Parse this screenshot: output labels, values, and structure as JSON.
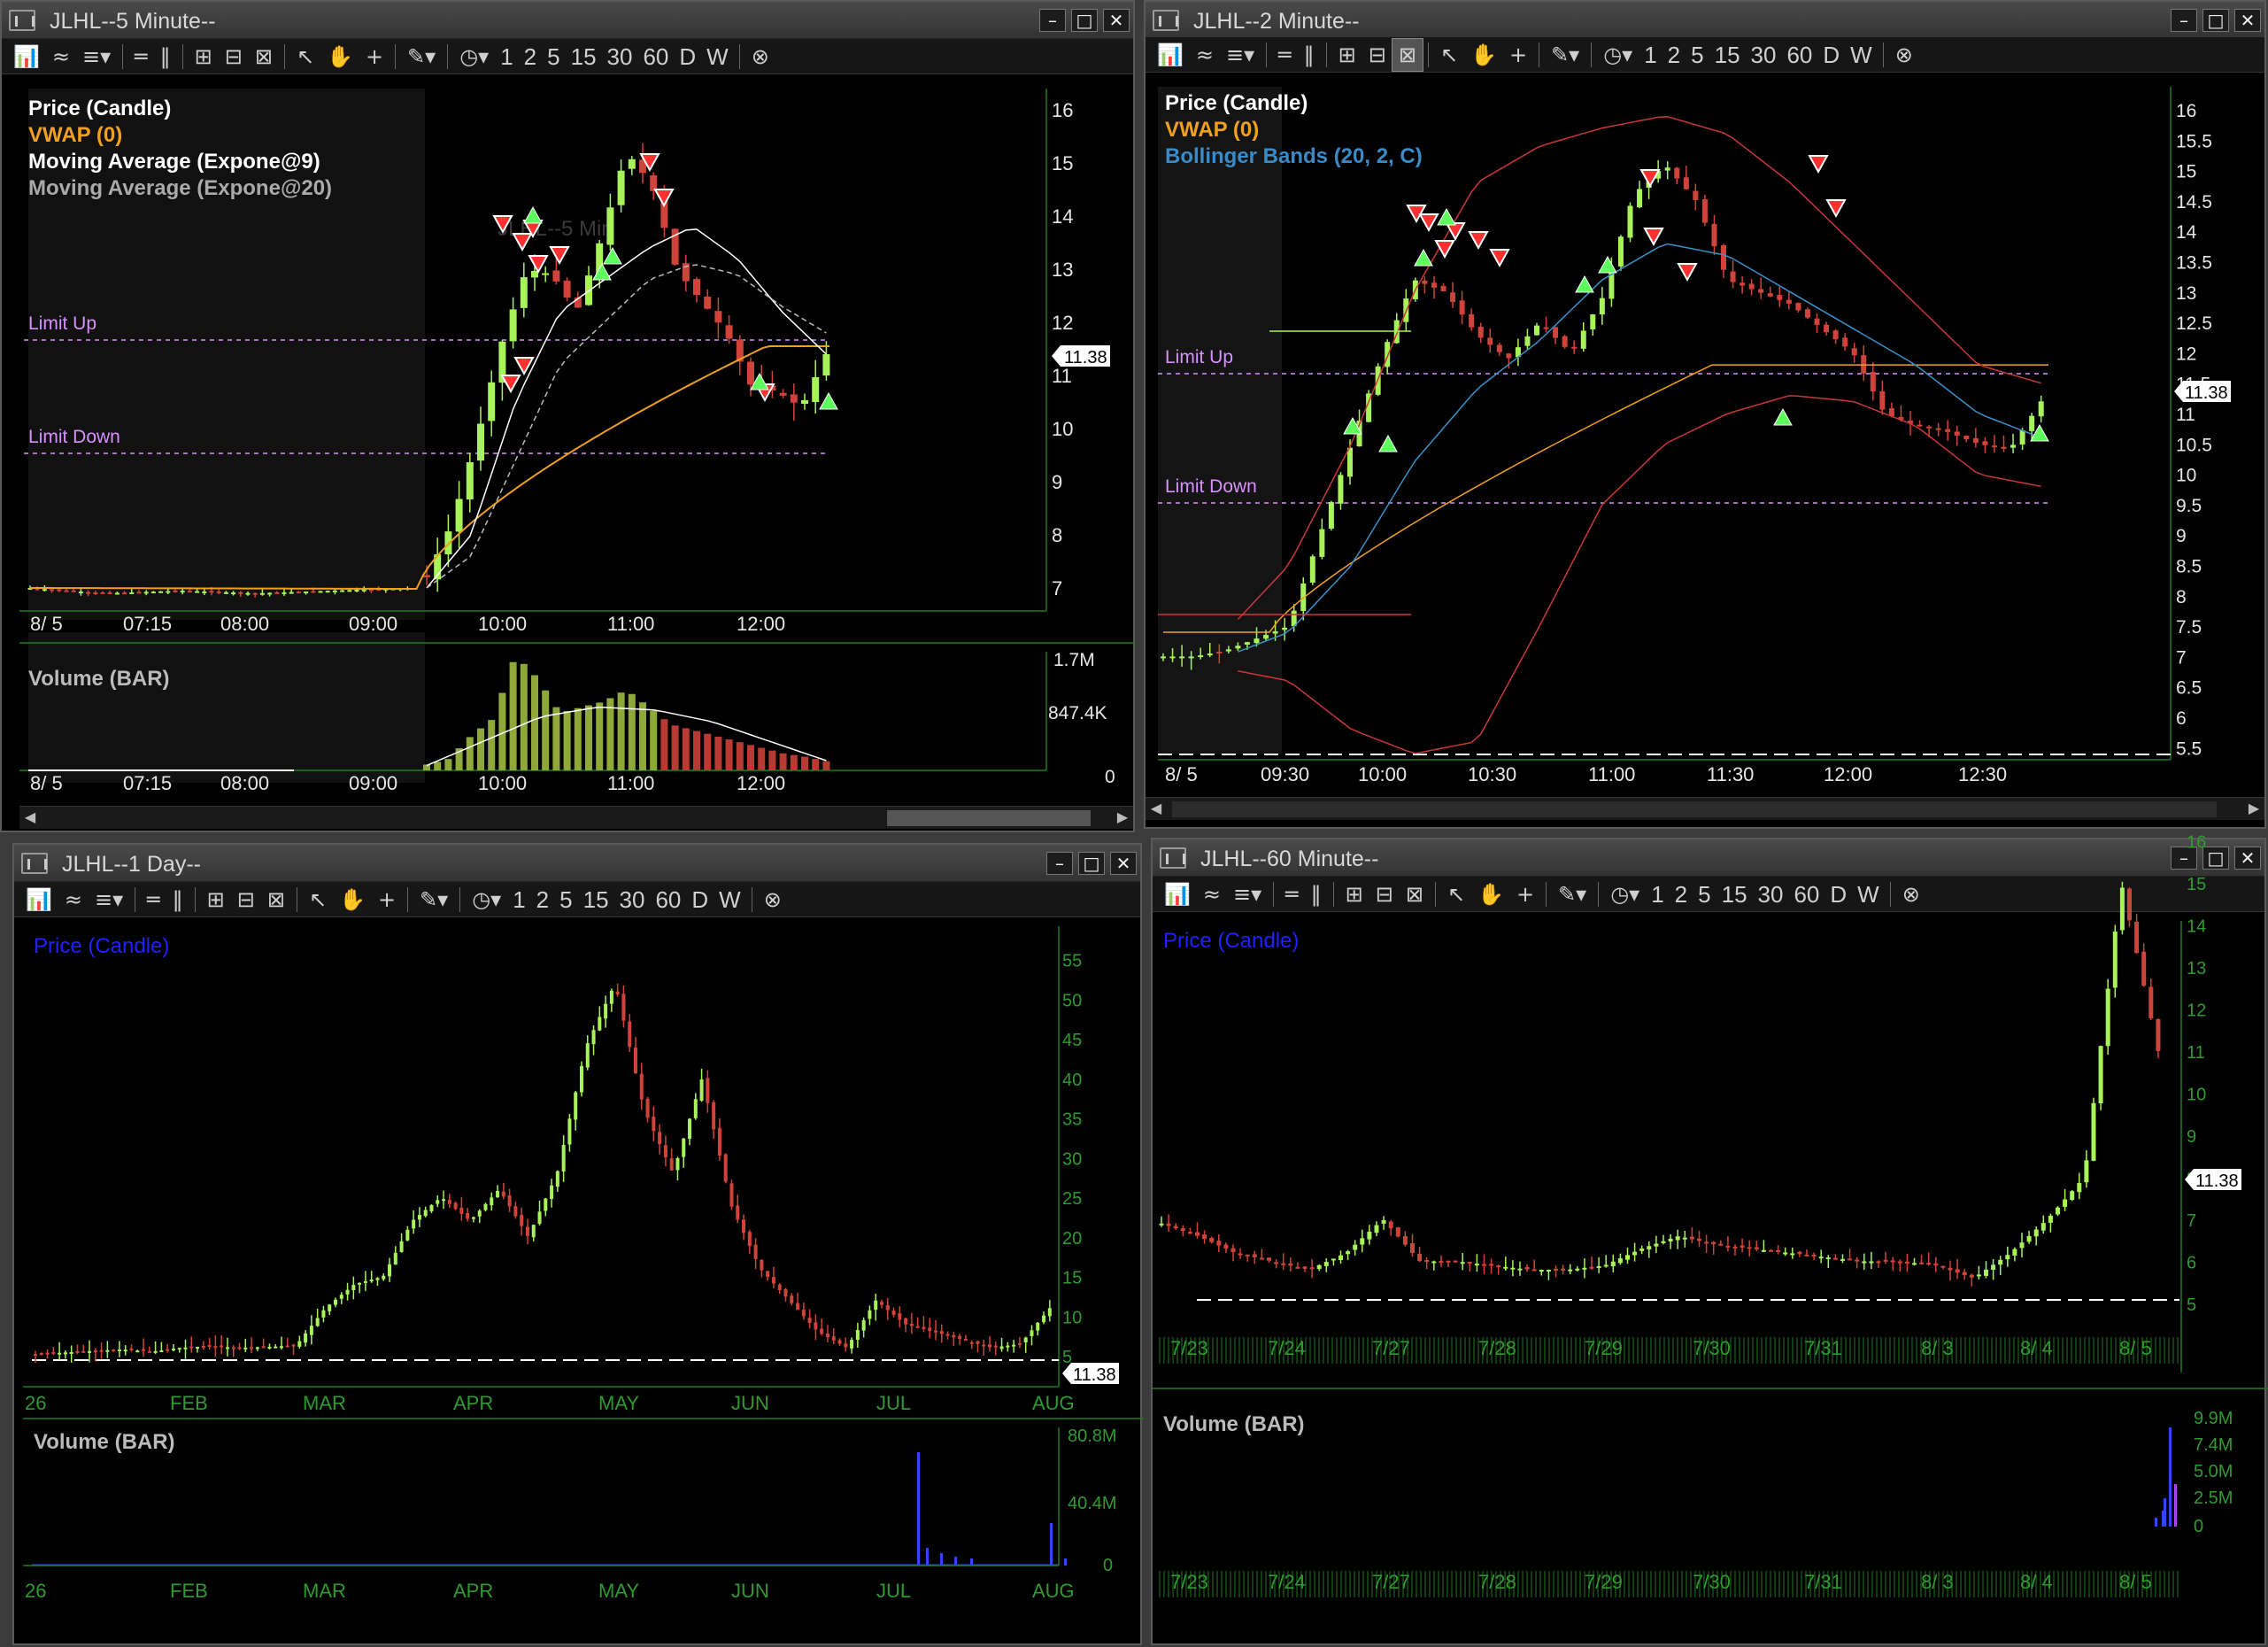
{
  "toolbar_numbers": [
    "1",
    "2",
    "5",
    "15",
    "30",
    "60",
    "D",
    "W"
  ],
  "windows": {
    "w5": {
      "title": "JLHL--5 Minute--",
      "legend": [
        "Price (Candle)",
        "VWAP (0)",
        "Moving Average (Expone@9)",
        "Moving Average (Expone@20)"
      ],
      "watermark": "JLHL--5 Min",
      "limit_up": "Limit Up",
      "limit_down": "Limit Down",
      "price_tag": "11.38",
      "y_ticks": [
        "16",
        "15",
        "14",
        "13",
        "12",
        "11",
        "10",
        "9",
        "8",
        "7"
      ],
      "x_ticks": [
        "8/ 5",
        "07:15",
        "08:00",
        "09:00",
        "10:00",
        "11:00",
        "12:00"
      ],
      "volume_title": "Volume (BAR)",
      "volume_ticks": [
        "1.7M",
        "847.4K",
        "0"
      ]
    },
    "w2": {
      "title": "JLHL--2 Minute--",
      "legend": [
        "Price (Candle)",
        "VWAP (0)",
        "Bollinger Bands (20, 2, C)"
      ],
      "limit_up": "Limit Up",
      "limit_down": "Limit Down",
      "price_tag": "11.38",
      "y_ticks": [
        "16",
        "15.5",
        "15",
        "14.5",
        "14",
        "13.5",
        "13",
        "12.5",
        "12",
        "11.5",
        "11",
        "10.5",
        "10",
        "9.5",
        "9",
        "8.5",
        "8",
        "7.5",
        "7",
        "6.5",
        "6",
        "5.5"
      ],
      "x_ticks": [
        "8/ 5",
        "09:30",
        "10:00",
        "10:30",
        "11:00",
        "11:30",
        "12:00",
        "12:30"
      ]
    },
    "wd": {
      "title": "JLHL--1 Day--",
      "legend": [
        "Price (Candle)"
      ],
      "price_tag": "11.38",
      "y_ticks": [
        "55",
        "50",
        "45",
        "40",
        "35",
        "30",
        "25",
        "20",
        "15",
        "10",
        "5"
      ],
      "x_ticks": [
        "26",
        "FEB",
        "MAR",
        "APR",
        "MAY",
        "JUN",
        "JUL",
        "AUG"
      ],
      "volume_title": "Volume (BAR)",
      "volume_ticks": [
        "80.8M",
        "40.4M",
        "0"
      ]
    },
    "w60": {
      "title": "JLHL--60 Minute--",
      "legend": [
        "Price (Candle)"
      ],
      "price_tag": "11.38",
      "y_ticks": [
        "16",
        "15",
        "14",
        "13",
        "12",
        "11",
        "10",
        "9",
        "8",
        "7",
        "6",
        "5"
      ],
      "x_ticks": [
        "7/23",
        "7/24",
        "7/27",
        "7/28",
        "7/29",
        "7/30",
        "7/31",
        "8/ 3",
        "8/ 4",
        "8/ 5"
      ],
      "volume_title": "Volume (BAR)",
      "volume_ticks": [
        "9.9M",
        "7.4M",
        "5.0M",
        "2.5M",
        "0"
      ]
    }
  },
  "colors": {
    "up": "#a8f25a",
    "down": "#d0433a",
    "vwap": "#f0a020",
    "ema9": "#ffffff",
    "ema20": "#bbbbbb",
    "limit": "#d890ff",
    "bollinger": "#c8383a",
    "bb_mid": "#3a90c8",
    "legend_blue": "#2020ff",
    "grid": "#1f7a1f"
  },
  "icons": [
    "chart-type-icon",
    "indicator-icon",
    "studies-dropdown-icon",
    "bar-spacing-icon",
    "split-icon",
    "zoom-in-icon",
    "zoom-out-icon",
    "zoom-fit-icon",
    "pointer-icon",
    "hand-icon",
    "crosshair-icon",
    "pencil-icon",
    "clock-icon",
    "close-circle-icon"
  ]
}
